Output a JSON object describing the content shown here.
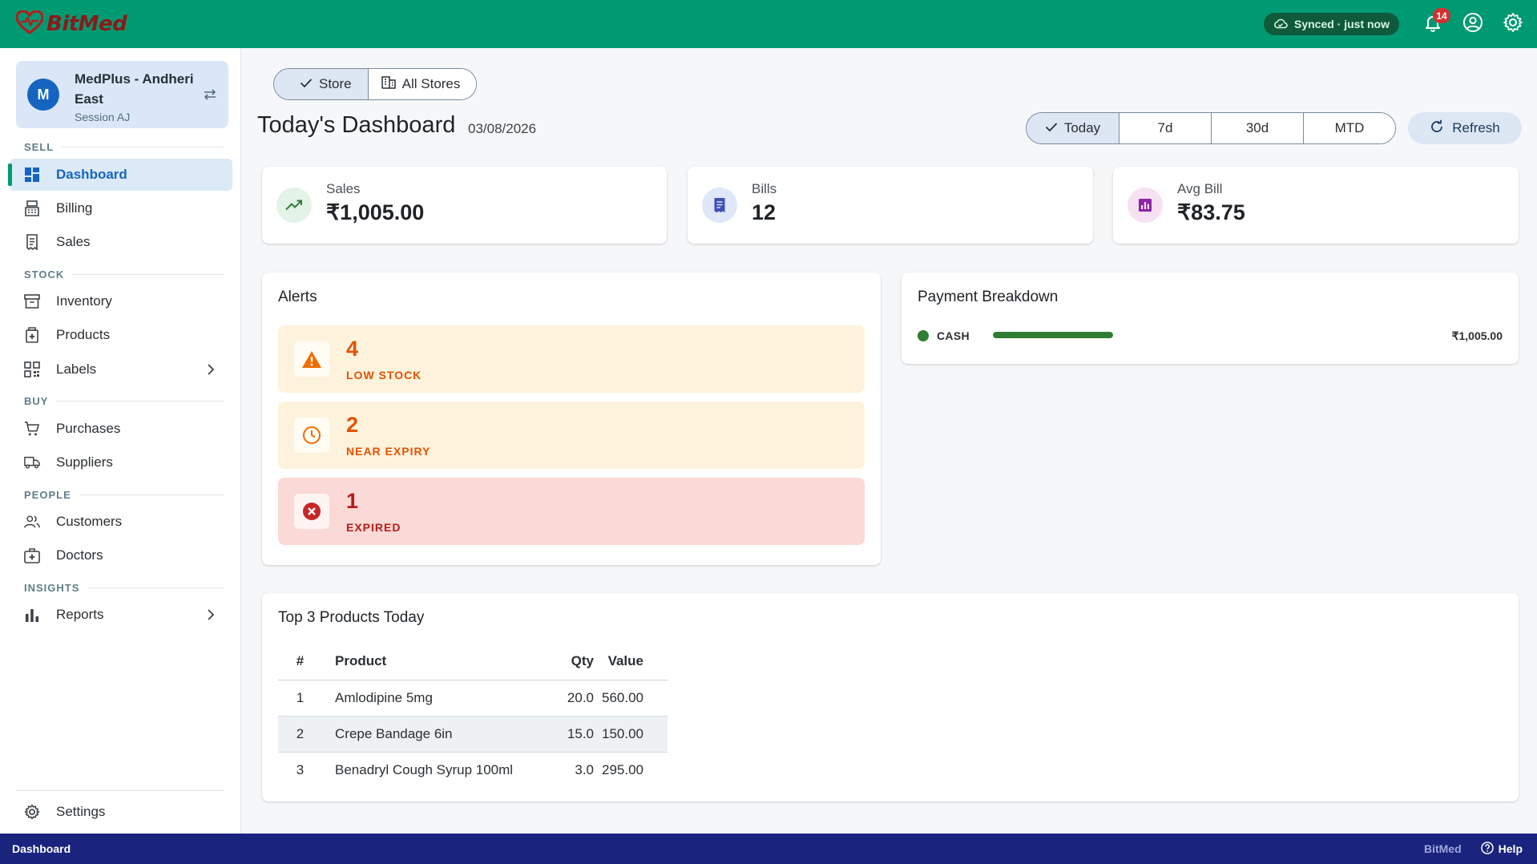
{
  "app": {
    "brand": "BitMed"
  },
  "topbar": {
    "sync_status": "Synced · just now",
    "notification_count": "14"
  },
  "sidebar": {
    "store": {
      "avatar_letter": "M",
      "name": "MedPlus - Andheri East",
      "session": "Session AJ"
    },
    "sections": {
      "sell": "SELL",
      "stock": "STOCK",
      "buy": "BUY",
      "people": "PEOPLE",
      "insights": "INSIGHTS"
    },
    "items": {
      "dashboard": "Dashboard",
      "billing": "Billing",
      "sales": "Sales",
      "inventory": "Inventory",
      "products": "Products",
      "labels": "Labels",
      "purchases": "Purchases",
      "suppliers": "Suppliers",
      "customers": "Customers",
      "doctors": "Doctors",
      "reports": "Reports",
      "settings": "Settings"
    },
    "active_item": "dashboard"
  },
  "main": {
    "scope": {
      "store": "Store",
      "all_stores": "All Stores",
      "selected": "store"
    },
    "title": "Today's Dashboard",
    "date": "03/08/2026",
    "ranges": {
      "today": "Today",
      "d7": "7d",
      "d30": "30d",
      "mtd": "MTD",
      "selected": "today"
    },
    "refresh": "Refresh",
    "stats": {
      "sales": {
        "label": "Sales",
        "value": "₹1,005.00"
      },
      "bills": {
        "label": "Bills",
        "value": "12"
      },
      "avg_bill": {
        "label": "Avg Bill",
        "value": "₹83.75"
      }
    },
    "alerts": {
      "title": "Alerts",
      "low_stock": {
        "count": "4",
        "label": "LOW STOCK"
      },
      "near_expiry": {
        "count": "2",
        "label": "NEAR EXPIRY"
      },
      "expired": {
        "count": "1",
        "label": "EXPIRED"
      }
    },
    "payment": {
      "title": "Payment Breakdown",
      "method": "CASH",
      "amount": "₹1,005.00",
      "share": 1.0
    },
    "top_products": {
      "title": "Top 3 Products Today",
      "headers": {
        "num": "#",
        "product": "Product",
        "qty": "Qty",
        "value": "Value"
      },
      "rows": [
        {
          "num": "1",
          "product": "Amlodipine 5mg",
          "qty": "20.0",
          "value": "560.00"
        },
        {
          "num": "2",
          "product": "Crepe Bandage 6in",
          "qty": "15.0",
          "value": "150.00"
        },
        {
          "num": "3",
          "product": "Benadryl Cough Syrup 100ml",
          "qty": "3.0",
          "value": "295.00"
        }
      ]
    }
  },
  "footer": {
    "page": "Dashboard",
    "brand": "BitMed",
    "help": "Help"
  },
  "colors": {
    "topbar": "#009a72",
    "footer": "#1a237e",
    "primary": "#1565c0",
    "warning": "#e65100",
    "danger": "#c62828",
    "cash": "#2e7d32"
  }
}
